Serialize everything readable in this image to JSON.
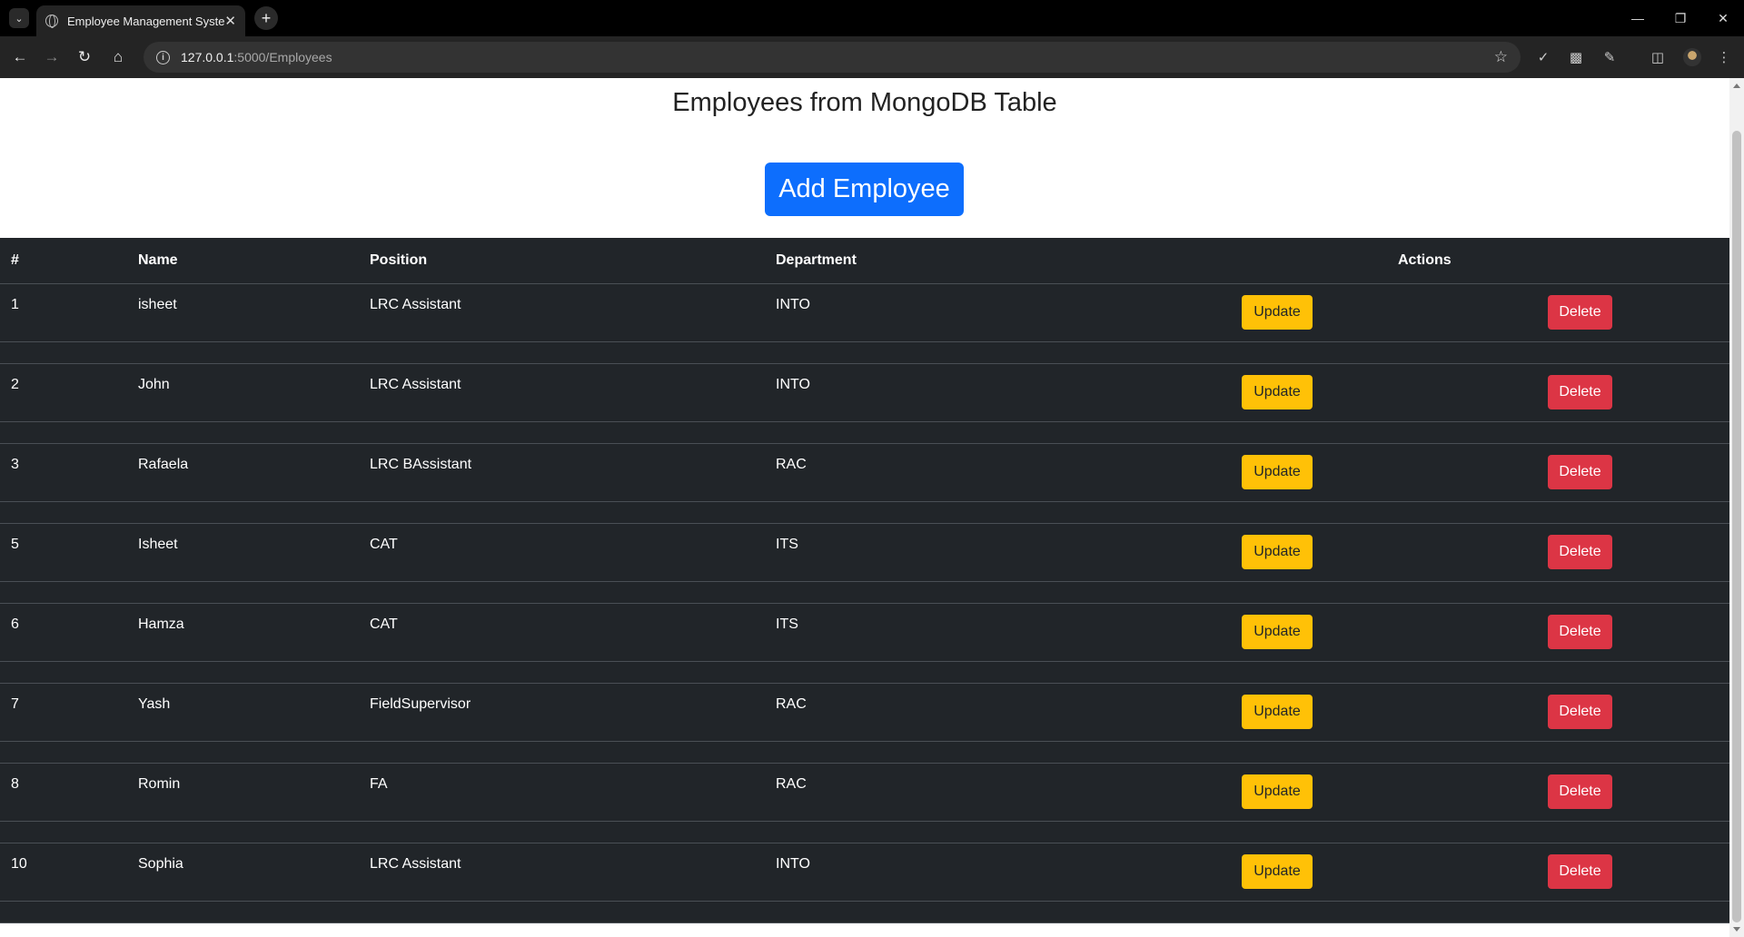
{
  "browser": {
    "tab_title": "Employee Management System",
    "url_host": "127.0.0.1",
    "url_path": ":5000/Employees"
  },
  "page": {
    "title": "Employees from MongoDB Table",
    "add_button": "Add Employee"
  },
  "table": {
    "headers": [
      "#",
      "Name",
      "Position",
      "Department",
      "Actions"
    ],
    "update_label": "Update",
    "delete_label": "Delete",
    "rows": [
      {
        "id": "1",
        "name": "isheet",
        "position": "LRC Assistant",
        "department": "INTO"
      },
      {
        "id": "2",
        "name": "John",
        "position": "LRC Assistant",
        "department": "INTO"
      },
      {
        "id": "3",
        "name": "Rafaela",
        "position": "LRC BAssistant",
        "department": "RAC"
      },
      {
        "id": "5",
        "name": "Isheet",
        "position": "CAT",
        "department": "ITS"
      },
      {
        "id": "6",
        "name": "Hamza",
        "position": "CAT",
        "department": "ITS"
      },
      {
        "id": "7",
        "name": "Yash",
        "position": "FieldSupervisor",
        "department": "RAC"
      },
      {
        "id": "8",
        "name": "Romin",
        "position": "FA",
        "department": "RAC"
      },
      {
        "id": "10",
        "name": "Sophia",
        "position": "LRC Assistant",
        "department": "INTO"
      }
    ]
  },
  "colors": {
    "primary": "#0d6efd",
    "warning": "#ffc107",
    "danger": "#dc3545",
    "table_dark": "#212529"
  }
}
